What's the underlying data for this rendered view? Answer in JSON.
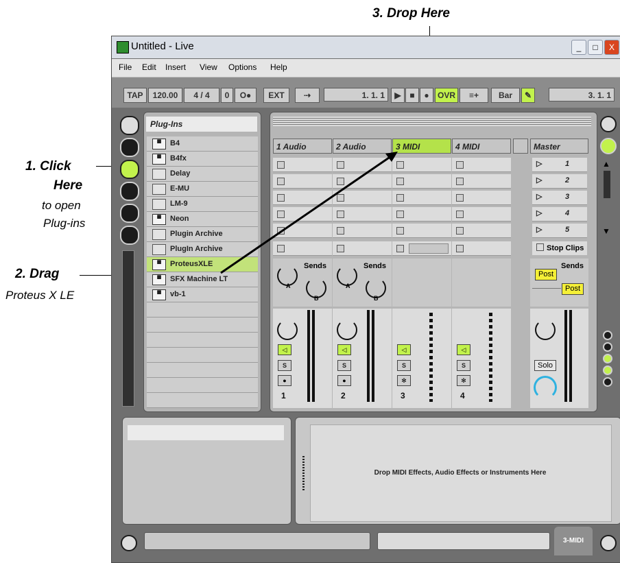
{
  "annotations": {
    "drop_title": "3. Drop Here",
    "click_title": "1. Click",
    "click_title2": "Here",
    "click_desc1": "to open",
    "click_desc2": "Plug-ins",
    "drag_title": "2. Drag",
    "drag_desc": "Proteus X LE"
  },
  "window": {
    "title": "Untitled - Live",
    "minimize": "_",
    "maximize": "□",
    "close": "X"
  },
  "menu": [
    "File",
    "Edit",
    "Insert",
    "View",
    "Options",
    "Help"
  ],
  "transport": {
    "tap": "TAP",
    "tempo": "120.00",
    "signature": "4 / 4",
    "nudge": "0",
    "metro": "O●",
    "ext": "EXT",
    "position": "1.  1.  1",
    "ovr": "OVR",
    "quantize": "Bar",
    "loop_pos": "3.  1.  1"
  },
  "browser": {
    "header": "Plug-Ins",
    "items": [
      {
        "label": "B4",
        "icon": "vst-icon"
      },
      {
        "label": "B4fx",
        "icon": "vst-icon"
      },
      {
        "label": "Delay",
        "icon": "folder-icon"
      },
      {
        "label": "E-MU",
        "icon": "folder-icon"
      },
      {
        "label": "LM-9",
        "icon": "folder-icon"
      },
      {
        "label": "Neon",
        "icon": "vst-icon"
      },
      {
        "label": "Plugin Archive",
        "icon": "folder-icon"
      },
      {
        "label": "PlugIn Archive",
        "icon": "folder-icon"
      },
      {
        "label": "ProteusXLE",
        "icon": "vst-icon"
      },
      {
        "label": "SFX Machine LT",
        "icon": "vst-icon"
      },
      {
        "label": "vb-1",
        "icon": "vst-icon"
      }
    ]
  },
  "tracks": [
    {
      "name": "1 Audio",
      "num": "1"
    },
    {
      "name": "2 Audio",
      "num": "2"
    },
    {
      "name": "3 MIDI",
      "num": "3"
    },
    {
      "name": "4 MIDI",
      "num": "4"
    }
  ],
  "mixer": {
    "sends": "Sends",
    "knob_a": "A",
    "knob_b": "B",
    "solo_short": "S",
    "solo": "Solo",
    "post": "Post",
    "icon_color_active": "#c2f24c"
  },
  "master": {
    "name": "Master",
    "scenes": [
      "1",
      "2",
      "3",
      "4",
      "5"
    ],
    "stop_clips": "Stop Clips"
  },
  "device": {
    "drop_hint": "Drop MIDI Effects, Audio Effects or Instruments Here",
    "track_tab": "3-MIDI"
  }
}
